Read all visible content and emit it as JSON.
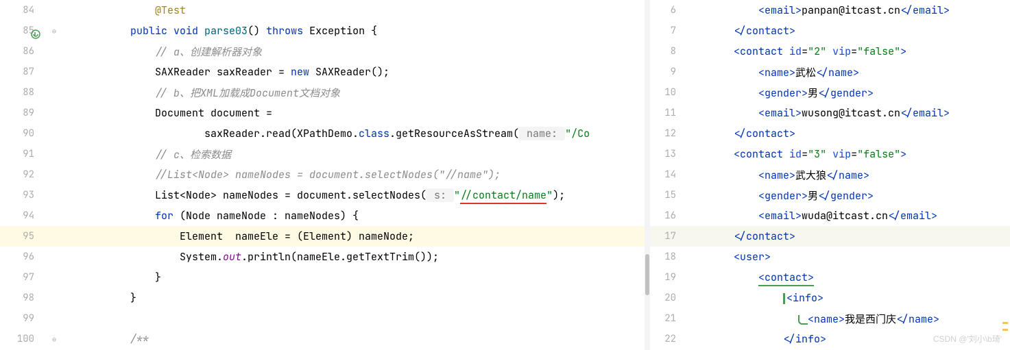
{
  "left": {
    "lines": [
      {
        "n": 84,
        "markers": [],
        "fold": "",
        "cls": "",
        "tokens": [
          {
            "c": "ann",
            "t": "            @Test"
          }
        ]
      },
      {
        "n": 85,
        "markers": [
          "run"
        ],
        "fold": "⊖",
        "cls": "",
        "tokens": [
          {
            "c": "",
            "t": "        "
          },
          {
            "c": "kw",
            "t": "public void "
          },
          {
            "c": "method",
            "t": "parse03"
          },
          {
            "c": "",
            "t": "() "
          },
          {
            "c": "kw",
            "t": "throws "
          },
          {
            "c": "",
            "t": "Exception {"
          }
        ]
      },
      {
        "n": 86,
        "markers": [],
        "fold": "",
        "cls": "",
        "tokens": [
          {
            "c": "",
            "t": "            "
          },
          {
            "c": "cmt",
            "t": "// a、创建解析器对象"
          }
        ]
      },
      {
        "n": 87,
        "markers": [],
        "fold": "",
        "cls": "",
        "tokens": [
          {
            "c": "",
            "t": "            SAXReader "
          },
          {
            "c": "",
            "t": "saxReader = "
          },
          {
            "c": "kw",
            "t": "new "
          },
          {
            "c": "",
            "t": "SAXReader();"
          }
        ]
      },
      {
        "n": 88,
        "markers": [],
        "fold": "",
        "cls": "",
        "tokens": [
          {
            "c": "",
            "t": "            "
          },
          {
            "c": "cmt",
            "t": "// b、把XML加载成Document文档对象"
          }
        ]
      },
      {
        "n": 89,
        "markers": [],
        "fold": "",
        "cls": "",
        "tokens": [
          {
            "c": "",
            "t": "            Document document ="
          }
        ]
      },
      {
        "n": 90,
        "markers": [],
        "fold": "",
        "cls": "",
        "tokens": [
          {
            "c": "",
            "t": "                    saxReader.read(XPathDemo."
          },
          {
            "c": "kw",
            "t": "class"
          },
          {
            "c": "",
            "t": ".getResourceAsStream("
          },
          {
            "c": "hint",
            "t": " name: "
          },
          {
            "c": "str",
            "t": "\"/Co"
          }
        ]
      },
      {
        "n": 91,
        "markers": [],
        "fold": "",
        "cls": "",
        "tokens": [
          {
            "c": "",
            "t": "            "
          },
          {
            "c": "cmt",
            "t": "// c、检索数据"
          }
        ]
      },
      {
        "n": 92,
        "markers": [],
        "fold": "",
        "cls": "",
        "tokens": [
          {
            "c": "",
            "t": "            "
          },
          {
            "c": "cmt",
            "t": "//List<Node> nameNodes = document.selectNodes(\"//name\");"
          }
        ]
      },
      {
        "n": 93,
        "markers": [],
        "fold": "",
        "cls": "",
        "tokens": [
          {
            "c": "",
            "t": "            List<Node> nameNodes = document.selectNodes("
          },
          {
            "c": "hint",
            "t": " s: "
          },
          {
            "c": "str",
            "t": "\""
          },
          {
            "c": "str red-underline",
            "t": "//contact/name"
          },
          {
            "c": "str",
            "t": "\""
          },
          {
            "c": "",
            "t": ");"
          }
        ]
      },
      {
        "n": 94,
        "markers": [],
        "fold": "",
        "cls": "",
        "tokens": [
          {
            "c": "",
            "t": "            "
          },
          {
            "c": "kw",
            "t": "for "
          },
          {
            "c": "",
            "t": "(Node nameNode : nameNodes) {"
          }
        ]
      },
      {
        "n": 95,
        "markers": [],
        "fold": "",
        "cls": "highlight",
        "tokens": [
          {
            "c": "",
            "t": "                Element  nameEle = (Element) nameNode;"
          }
        ]
      },
      {
        "n": 96,
        "markers": [],
        "fold": "",
        "cls": "",
        "tokens": [
          {
            "c": "",
            "t": "                System."
          },
          {
            "c": "fld",
            "t": "out"
          },
          {
            "c": "",
            "t": ".println(nameEle.getTextTrim());"
          }
        ]
      },
      {
        "n": 97,
        "markers": [],
        "fold": "",
        "cls": "",
        "tokens": [
          {
            "c": "",
            "t": "            }"
          }
        ]
      },
      {
        "n": 98,
        "markers": [],
        "fold": "",
        "cls": "",
        "tokens": [
          {
            "c": "",
            "t": "        }"
          }
        ]
      },
      {
        "n": 99,
        "markers": [],
        "fold": "",
        "cls": "",
        "tokens": [
          {
            "c": "",
            "t": ""
          }
        ]
      },
      {
        "n": 100,
        "markers": [],
        "fold": "⊖",
        "cls": "",
        "tokens": [
          {
            "c": "",
            "t": "        "
          },
          {
            "c": "cmt",
            "t": "/**"
          }
        ]
      }
    ]
  },
  "right": {
    "lines": [
      {
        "n": 6,
        "cls": "",
        "html": "            <span class='tag'>&lt;email&gt;</span><span class='txt'>panpan@itcast.cn</span><span class='tag'>&lt;/email&gt;</span>"
      },
      {
        "n": 7,
        "cls": "",
        "html": "        <span class='tag'>&lt;/contact&gt;</span>"
      },
      {
        "n": 8,
        "cls": "",
        "html": "        <span class='tag'>&lt;contact</span> <span class='attr'>id</span>=<span class='attrv'>\"2\"</span> <span class='attr'>vip</span>=<span class='attrv'>\"false\"</span><span class='tag'>&gt;</span>"
      },
      {
        "n": 9,
        "cls": "",
        "html": "            <span class='tag'>&lt;name&gt;</span><span class='txt'>武松</span><span class='tag'>&lt;/name&gt;</span>"
      },
      {
        "n": 10,
        "cls": "",
        "html": "            <span class='tag'>&lt;gender&gt;</span><span class='txt'>男</span><span class='tag'>&lt;/gender&gt;</span>"
      },
      {
        "n": 11,
        "cls": "",
        "html": "            <span class='tag'>&lt;email&gt;</span><span class='txt'>wusong@itcast.cn</span><span class='tag'>&lt;/email&gt;</span>"
      },
      {
        "n": 12,
        "cls": "",
        "html": "        <span class='tag'>&lt;/contact&gt;</span>"
      },
      {
        "n": 13,
        "cls": "",
        "html": "        <span class='tag'>&lt;contact</span> <span class='attr'>id</span>=<span class='attrv'>\"3\"</span> <span class='attr'>vip</span>=<span class='attrv'>\"false\"</span><span class='tag'>&gt;</span>"
      },
      {
        "n": 14,
        "cls": "",
        "html": "            <span class='tag'>&lt;name&gt;</span><span class='txt'>武大狼</span><span class='tag'>&lt;/name&gt;</span>"
      },
      {
        "n": 15,
        "cls": "",
        "html": "            <span class='tag'>&lt;gender&gt;</span><span class='txt'>男</span><span class='tag'>&lt;/gender&gt;</span>"
      },
      {
        "n": 16,
        "cls": "",
        "html": "            <span class='tag'>&lt;email&gt;</span><span class='txt'>wuda@itcast.cn</span><span class='tag'>&lt;/email&gt;</span>"
      },
      {
        "n": 17,
        "cls": "caret-line",
        "html": "        <span class='tag'>&lt;/contact&gt;</span>"
      },
      {
        "n": 18,
        "cls": "",
        "html": "        <span class='tag'>&lt;user&gt;</span>"
      },
      {
        "n": 19,
        "cls": "",
        "html": "            <span class='tag green-underline'>&lt;contact&gt;</span>"
      },
      {
        "n": 20,
        "cls": "",
        "html": "                <span class='vbar-green'></span><span class='tag'>&lt;info&gt;</span>"
      },
      {
        "n": 21,
        "cls": "",
        "html": "                    <span class='squig-green'></span><span class='tag'>&lt;name&gt;</span><span class='txt'>我是西门庆</span><span class='tag'>&lt;/name&gt;</span>"
      },
      {
        "n": 22,
        "cls": "",
        "html": "                <span class='tag'>&lt;/info&gt;</span>"
      }
    ]
  },
  "watermark": "CSDN @'刘小\\b琦'"
}
